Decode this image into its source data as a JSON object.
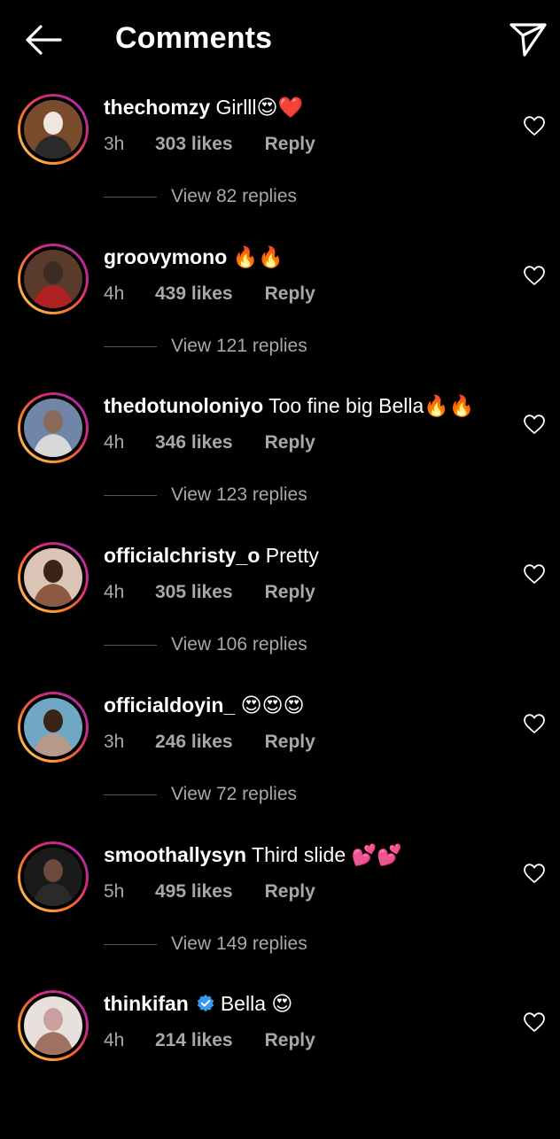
{
  "header": {
    "title": "Comments"
  },
  "comments": [
    {
      "username": "thechomzy",
      "text": "Girlll😍❤️",
      "verified": false,
      "time": "3h",
      "likes": "303 likes",
      "reply": "Reply",
      "view_replies": "View 82 replies",
      "avatar_colors": [
        "#7a4a2c",
        "#efe6e0",
        "#2a2a2a"
      ]
    },
    {
      "username": "groovymono",
      "text": "🔥🔥",
      "verified": false,
      "time": "4h",
      "likes": "439 likes",
      "reply": "Reply",
      "view_replies": "View 121 replies",
      "avatar_colors": [
        "#5a3a2a",
        "#3a2b25",
        "#b02020"
      ]
    },
    {
      "username": "thedotunoloniyo",
      "text": "Too fine big Bella🔥🔥",
      "verified": false,
      "time": "4h",
      "likes": "346 likes",
      "reply": "Reply",
      "view_replies": "View 123 replies",
      "avatar_colors": [
        "#6f86a8",
        "#8a6a5a",
        "#d8d8d8"
      ]
    },
    {
      "username": "officialchristy_o",
      "text": "Pretty",
      "verified": false,
      "time": "4h",
      "likes": "305 likes",
      "reply": "Reply",
      "view_replies": "View 106 replies",
      "avatar_colors": [
        "#d9c4b6",
        "#3a2418",
        "#8c5a40"
      ]
    },
    {
      "username": "officialdoyin_",
      "text": "😍😍😍",
      "verified": false,
      "time": "3h",
      "likes": "246 likes",
      "reply": "Reply",
      "view_replies": "View 72 replies",
      "avatar_colors": [
        "#6fa7c4",
        "#3a2418",
        "#b89a8a"
      ]
    },
    {
      "username": "smoothallysyn",
      "text": "Third slide 💕💕",
      "verified": false,
      "time": "5h",
      "likes": "495 likes",
      "reply": "Reply",
      "view_replies": "View 149 replies",
      "avatar_colors": [
        "#1a1a1a",
        "#6a4a3a",
        "#2a2a2a"
      ]
    },
    {
      "username": "thinkifan",
      "text": "Bella 😍",
      "verified": true,
      "time": "4h",
      "likes": "214 likes",
      "reply": "Reply",
      "view_replies": "",
      "avatar_colors": [
        "#e8e0dc",
        "#c8a0a0",
        "#a07060"
      ]
    }
  ],
  "colors": {
    "background": "#000000",
    "text": "#ffffff",
    "secondary": "#a8a8a8",
    "verified": "#3897f0"
  },
  "icons": {
    "back": "arrow-left-icon",
    "share": "paper-plane-icon",
    "like": "heart-outline-icon",
    "verified": "verified-badge-icon"
  }
}
